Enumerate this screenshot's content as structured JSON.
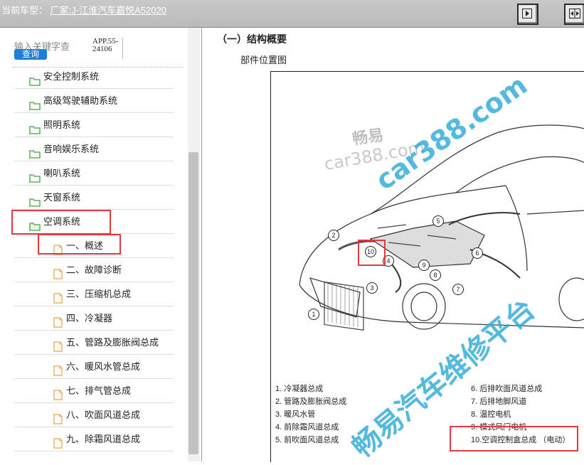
{
  "header": {
    "title_prefix": "当前车型：",
    "title_model": "厂家:J-江淮汽车嘉悦A52020",
    "btn_a_icon": "expand-right-icon",
    "btn_b_icon": "split-panes-icon"
  },
  "sidebar": {
    "search_label": "输入关键字查",
    "search_button": "查询",
    "app_code": "APP.55-24106",
    "items": [
      {
        "label": "安全控制系统",
        "type": "folder"
      },
      {
        "label": "高级驾驶辅助系统",
        "type": "folder"
      },
      {
        "label": "照明系统",
        "type": "folder"
      },
      {
        "label": "音响娱乐系统",
        "type": "folder"
      },
      {
        "label": "喇叭系统",
        "type": "folder"
      },
      {
        "label": "天窗系统",
        "type": "folder"
      },
      {
        "label": "空调系统",
        "type": "folder-open"
      },
      {
        "label": "一、概述",
        "type": "doc"
      },
      {
        "label": "二、故障诊断",
        "type": "doc"
      },
      {
        "label": "三、压缩机总成",
        "type": "doc"
      },
      {
        "label": "四、冷凝器",
        "type": "doc"
      },
      {
        "label": "五、管路及膨胀阀总成",
        "type": "doc"
      },
      {
        "label": "六、暖风水管总成",
        "type": "doc"
      },
      {
        "label": "七、排气管总成",
        "type": "doc"
      },
      {
        "label": "八、吹面风道总成",
        "type": "doc"
      },
      {
        "label": "九、除霜风道总成",
        "type": "doc"
      }
    ]
  },
  "content": {
    "section_title": "（一）结构概要",
    "sub_title": "部件位置图",
    "callouts": [
      "1",
      "2",
      "3",
      "4",
      "5",
      "6",
      "7",
      "8",
      "9",
      "10"
    ],
    "legend_left": [
      "1. 冷凝器总成",
      "2. 管路及膨胀阀总成",
      "3. 暖风水管",
      "4. 前除霜风道总成",
      "5. 前吹面风道总成"
    ],
    "legend_right": [
      "6. 后排吹面风道总成",
      "7. 后排地脚风道",
      "8. 温控电机",
      "9. 模式风门电机",
      "10.空调控制盒总成 （电动）"
    ],
    "watermarks": [
      "畅易",
      "car388.com",
      "car388.com",
      "畅易汽车维修平台"
    ]
  },
  "colors": {
    "highlight": "#e23a3a",
    "accent": "#1e7fd6",
    "folder": "#3fa23f",
    "doc": "#e8a048",
    "watermark": "#2aa8d8"
  }
}
